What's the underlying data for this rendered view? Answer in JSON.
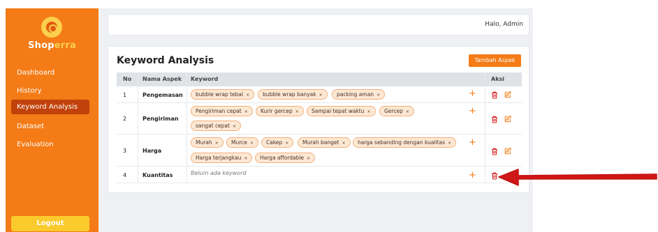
{
  "brand": {
    "part1": "Shop",
    "part2": "erra"
  },
  "nav": {
    "items": [
      {
        "label": "Dashboard"
      },
      {
        "label": "History"
      },
      {
        "label": "Keyword Analysis"
      },
      {
        "label": "Dataset"
      },
      {
        "label": "Evaluation"
      }
    ],
    "active_index": 2,
    "logout_label": "Logout"
  },
  "topbar": {
    "greeting": "Halo, Admin"
  },
  "card": {
    "title": "Keyword Analysis",
    "add_label": "Tambah Aspek",
    "headers": {
      "no": "No",
      "name": "Nama Aspek",
      "keyword": "Keyword",
      "actions": "Aksi"
    },
    "rows": [
      {
        "no": "1",
        "name": "Pengemasan",
        "keywords": [
          "bubble wrap tebal",
          "bubble wrap banyak",
          "packing aman"
        ],
        "has_edit": true
      },
      {
        "no": "2",
        "name": "Pengiriman",
        "keywords": [
          "Pengiriman cepat",
          "Kurir gercep",
          "Sampai tepat waktu",
          "Gercep",
          "sangat cepat"
        ],
        "has_edit": true
      },
      {
        "no": "3",
        "name": "Harga",
        "keywords": [
          "Murah",
          "Murce",
          "Cakep",
          "Murah banget",
          "harga sebanding dengan kualitas",
          "Harga terjangkau",
          "Harga affordable"
        ],
        "has_edit": true
      },
      {
        "no": "4",
        "name": "Kuantitas",
        "keywords": [],
        "empty_text": "Belum ada keyword",
        "has_edit": false
      }
    ],
    "chip_remove": "×",
    "add_keyword": "+"
  },
  "colors": {
    "brand": "#f47b16",
    "sidebar_active": "#c1420a",
    "logout": "#fbca2d",
    "delete": "#d62020",
    "edit": "#f47b16",
    "annotation_arrow": "#d01717"
  },
  "icons": {
    "delete": "trash-icon",
    "edit": "pencil-icon",
    "add": "plus-icon",
    "logo": "shoperra-logo-icon"
  }
}
